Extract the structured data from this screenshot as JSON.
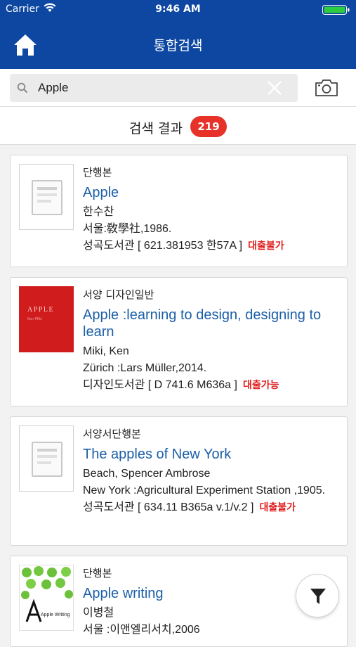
{
  "status": {
    "carrier": "Carrier",
    "time": "9:46 AM"
  },
  "header": {
    "title": "통합검색"
  },
  "search": {
    "query": "Apple"
  },
  "results": {
    "label": "검색 결과",
    "count": "219"
  },
  "items": [
    {
      "type": "단행본",
      "title": "Apple",
      "author": "한수찬",
      "publisher": "서울:敎學社,1986.",
      "location": "성곡도서관 [ 621.381953 한57A ]",
      "availability": "대출불가"
    },
    {
      "type": "서양 디자인일반",
      "title": "Apple :learning to design, designing to learn",
      "author": "Miki, Ken",
      "publisher": "Zürich :Lars Müller,2014.",
      "location": "디자인도서관 [ D 741.6 M636a ]",
      "availability": "대출가능",
      "cover_title": "APPLE",
      "cover_sub": "Ken Miki"
    },
    {
      "type": "서양서단행본",
      "title": "The apples of New York",
      "author": "Beach, Spencer Ambrose",
      "publisher": "New York :Agricultural Experiment Station ,1905.",
      "location": "성곡도서관 [ 634.11 B365a v.1/v.2 ]",
      "availability": "대출불가"
    },
    {
      "type": "단행본",
      "title": "Apple writing",
      "author": "이병철",
      "publisher": "서울 :이앤엘리서치,2006",
      "cover_title": "Apple Writing"
    }
  ],
  "colors": {
    "header": "#0d47a1",
    "badge": "#e63228",
    "title_link": "#1b5fa8",
    "availability": "#e02020"
  }
}
